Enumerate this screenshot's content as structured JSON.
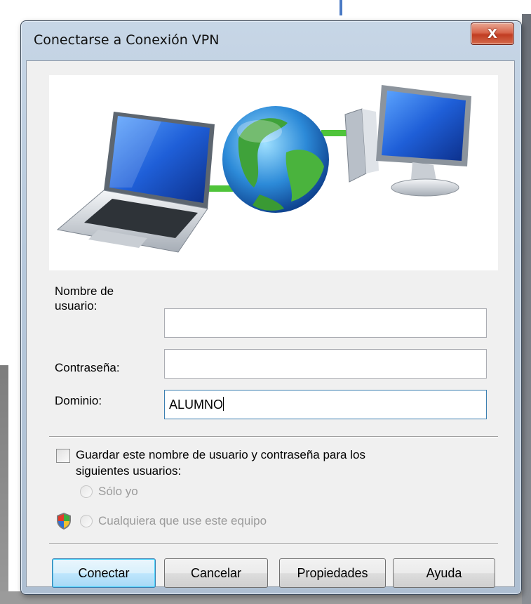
{
  "window": {
    "title": "Conectarse a Conexión VPN",
    "close_glyph": "X"
  },
  "form": {
    "username_label": "Nombre de usuario:",
    "username_value": "",
    "password_label": "Contraseña:",
    "password_value": "",
    "domain_label": "Dominio:",
    "domain_value": "ALUMNO"
  },
  "save": {
    "checkbox_label_line1": "Guardar este nombre de usuario y contraseña para los",
    "checkbox_label_line2": "siguientes usuarios:",
    "checked": false,
    "option_me": "Sólo yo",
    "option_anyone": "Cualquiera que use este equipo"
  },
  "buttons": {
    "connect": "Conectar",
    "cancel": "Cancelar",
    "properties": "Propiedades",
    "help": "Ayuda"
  },
  "icons": [
    "laptop-icon",
    "globe-icon",
    "desktop-computer-icon",
    "uac-shield-icon",
    "close-icon"
  ],
  "colors": {
    "close_button": "#c13d22",
    "default_button_border": "#3c7fb1",
    "connection_line": "#4fc43a"
  }
}
